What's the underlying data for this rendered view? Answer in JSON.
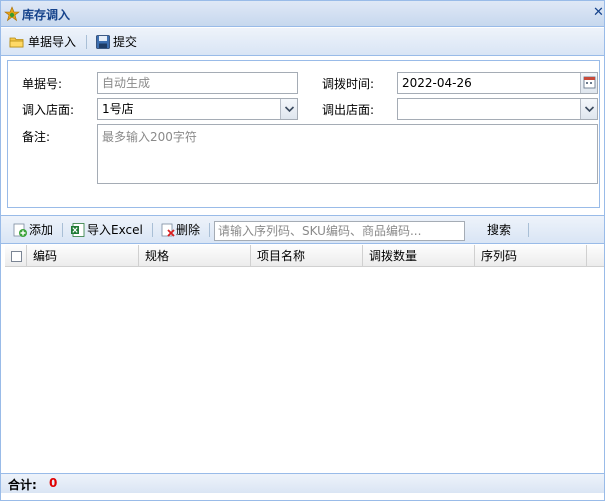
{
  "window": {
    "title": "库存调入"
  },
  "toolbar": {
    "import_label": "单据导入",
    "submit_label": "提交"
  },
  "form": {
    "doc_no_label": "单据号:",
    "doc_no_placeholder": "自动生成",
    "transfer_time_label": "调拨时间:",
    "transfer_time_value": "2022-04-26",
    "in_store_label": "调入店面:",
    "in_store_value": "1号店",
    "out_store_label": "调出店面:",
    "out_store_value": "",
    "remark_label": "备注:",
    "remark_placeholder": "最多输入200字符"
  },
  "grid_toolbar": {
    "add_label": "添加",
    "import_excel_label": "导入Excel",
    "delete_label": "删除",
    "search_placeholder": "请输入序列码、SKU编码、商品编码...",
    "search_label": "搜索"
  },
  "grid": {
    "columns": [
      "编码",
      "规格",
      "项目名称",
      "调拨数量",
      "序列码"
    ]
  },
  "footer": {
    "total_label": "合计:",
    "total_value": "0"
  },
  "colors": {
    "accent": "#15428b",
    "total": "#e00000"
  }
}
